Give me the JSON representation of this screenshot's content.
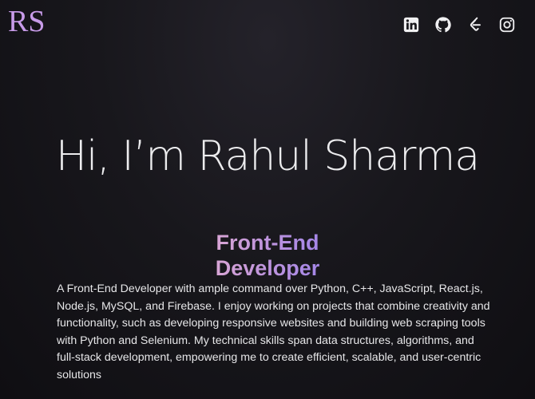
{
  "header": {
    "logo_text": "RS",
    "logo_color": "#c79be8",
    "social_links": [
      {
        "name": "linkedin",
        "icon": "linkedin-icon"
      },
      {
        "name": "github",
        "icon": "github-icon"
      },
      {
        "name": "leetcode",
        "icon": "leetcode-icon"
      },
      {
        "name": "instagram",
        "icon": "instagram-icon"
      }
    ]
  },
  "hero": {
    "title": "Hi, I’m Rahul Sharma",
    "role": "Front-End Developer",
    "role_gradient": [
      "#f3b8cf",
      "#c89ad9",
      "#8b78f2"
    ],
    "description": "A Front-End Developer with ample command over Python, C++, JavaScript, React.js, Node.js, MySQL, and Firebase. I enjoy working on projects that combine creativity and functionality, such as developing responsive websites and building web scraping tools with Python and Selenium. My technical skills span data structures, algorithms, and full-stack development, empowering me to create efficient, scalable, and user-centric solutions"
  },
  "colors": {
    "background": "#18171c",
    "text": "#e8e8ea",
    "icon": "#f0f0f2"
  }
}
